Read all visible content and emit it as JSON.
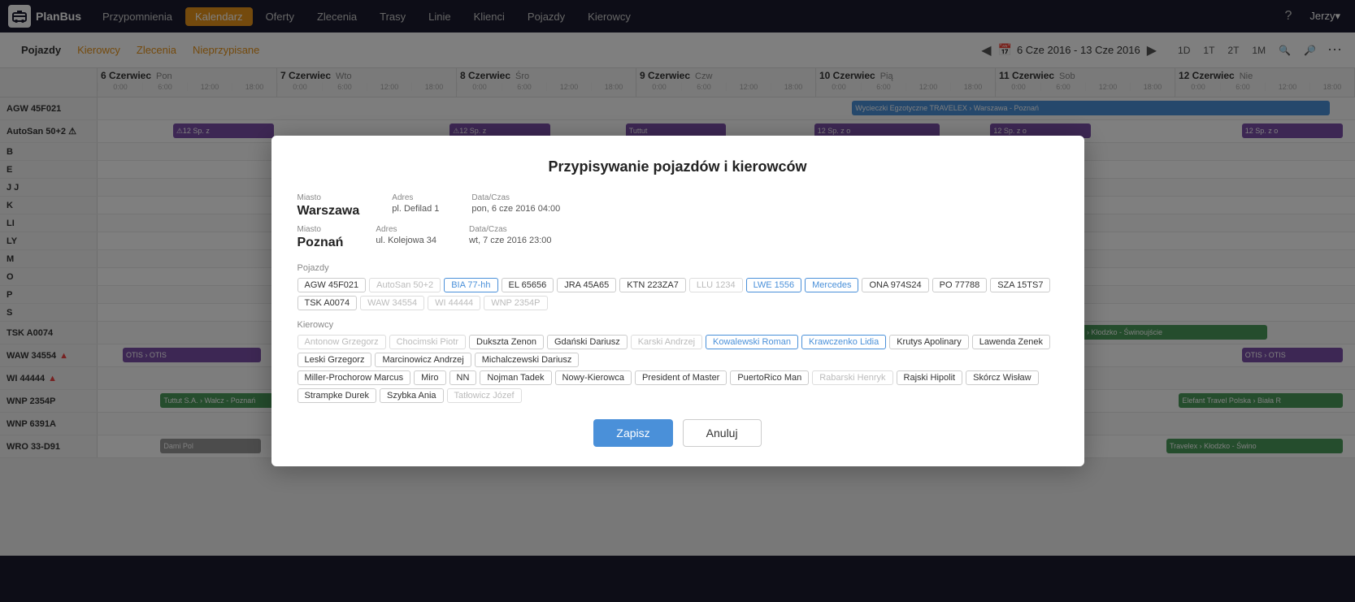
{
  "app": {
    "logo_text": "PlanBus"
  },
  "topnav": {
    "items": [
      {
        "id": "przypomnienia",
        "label": "Przypomnienia",
        "active": false
      },
      {
        "id": "kalendarz",
        "label": "Kalendarz",
        "active": true
      },
      {
        "id": "oferty",
        "label": "Oferty",
        "active": false
      },
      {
        "id": "zlecenia",
        "label": "Zlecenia",
        "active": false
      },
      {
        "id": "trasy",
        "label": "Trasy",
        "active": false
      },
      {
        "id": "linie",
        "label": "Linie",
        "active": false
      },
      {
        "id": "klienci",
        "label": "Klienci",
        "active": false
      },
      {
        "id": "pojazdy",
        "label": "Pojazdy",
        "active": false
      },
      {
        "id": "kierowcy",
        "label": "Kierowcy",
        "active": false
      }
    ],
    "user_label": "Jerzy▾",
    "help_label": "?"
  },
  "subheader": {
    "tabs": [
      {
        "id": "pojazdy",
        "label": "Pojazdy",
        "active": true,
        "orange": false
      },
      {
        "id": "kierowcy",
        "label": "Kierowcy",
        "active": false,
        "orange": true
      },
      {
        "id": "zlecenia",
        "label": "Zlecenia",
        "active": false,
        "orange": true
      },
      {
        "id": "nieprzypisane",
        "label": "Nieprzypisane",
        "active": false,
        "orange": true
      }
    ],
    "date_range": "6 Cze 2016 - 13 Cze 2016",
    "zoom_buttons": [
      "1D",
      "1T",
      "2T",
      "1M"
    ],
    "zoom_in_icon": "🔍",
    "zoom_out_icon": "🔎"
  },
  "calendar": {
    "days": [
      {
        "date": "6 Czerwiec",
        "day": "Pon",
        "times": [
          "0:00",
          "6:00",
          "12:00",
          "18:00"
        ]
      },
      {
        "date": "7 Czerwiec",
        "day": "Wto",
        "times": [
          "0:00",
          "6:00",
          "12:00",
          "18:00"
        ]
      },
      {
        "date": "8 Czerwiec",
        "day": "Śro",
        "times": [
          "0:00",
          "6:00",
          "12:00",
          "18:00"
        ]
      },
      {
        "date": "9 Czerwiec",
        "day": "Czw",
        "times": [
          "0:00",
          "6:00",
          "12:00",
          "18:00"
        ]
      },
      {
        "date": "10 Czerwiec",
        "day": "Pią",
        "times": [
          "0:00",
          "6:00",
          "12:00",
          "18:00"
        ]
      },
      {
        "date": "11 Czerwiec",
        "day": "Sob",
        "times": [
          "0:00",
          "6:00",
          "12:00",
          "18:00"
        ]
      },
      {
        "date": "12 Czerwiec",
        "day": "Nie",
        "times": [
          "0:00",
          "6:00",
          "12:00",
          "18:00"
        ]
      }
    ],
    "vehicles": [
      {
        "id": "AGW45F021",
        "label": "AGW 45F021"
      },
      {
        "id": "AutoSan50",
        "label": "AutoSan 50+2"
      },
      {
        "id": "B",
        "label": "B"
      },
      {
        "id": "E",
        "label": "E"
      },
      {
        "id": "JJ",
        "label": "J J"
      },
      {
        "id": "K",
        "label": "K"
      },
      {
        "id": "LI",
        "label": "LI"
      },
      {
        "id": "LY",
        "label": "LY"
      },
      {
        "id": "M",
        "label": "M"
      },
      {
        "id": "O",
        "label": "O"
      },
      {
        "id": "P",
        "label": "P"
      },
      {
        "id": "S",
        "label": "S"
      }
    ]
  },
  "modal": {
    "title": "Przypisywanie pojazdów i kierowców",
    "from": {
      "city_label": "Miasto",
      "city": "Warszawa",
      "addr_label": "Adres",
      "addr": "pl. Defilad 1",
      "dt_label": "Data/Czas",
      "dt": "pon, 6 cze 2016 04:00"
    },
    "to": {
      "city_label": "Miasto",
      "city": "Poznań",
      "addr_label": "Adres",
      "addr": "ul. Kolejowa 34",
      "dt_label": "Data/Czas",
      "dt": "wt, 7 cze 2016 23:00"
    },
    "vehicles_label": "Pojazdy",
    "vehicles": [
      {
        "id": "AGW45F021",
        "label": "AGW 45F021",
        "selected": "none"
      },
      {
        "id": "AutoSan50",
        "label": "AutoSan 50+2",
        "selected": "none"
      },
      {
        "id": "BIA77hh",
        "label": "BIA 77-hh",
        "selected": "blue"
      },
      {
        "id": "EL65656",
        "label": "EL 65656",
        "selected": "none"
      },
      {
        "id": "JRA45A65",
        "label": "JRA 45A65",
        "selected": "none"
      },
      {
        "id": "KTN223ZA7",
        "label": "KTN 223ZA7",
        "selected": "none"
      },
      {
        "id": "LLU1234",
        "label": "LLU 1234",
        "selected": "none"
      },
      {
        "id": "LWE1556",
        "label": "LWE 1556",
        "selected": "blue"
      },
      {
        "id": "Mercedes",
        "label": "Mercedes",
        "selected": "blue"
      },
      {
        "id": "ONA974S24",
        "label": "ONA 974S24",
        "selected": "none"
      },
      {
        "id": "PO77788",
        "label": "PO 77788",
        "selected": "none"
      },
      {
        "id": "SZA15TS7",
        "label": "SZA 15TS7",
        "selected": "none"
      },
      {
        "id": "TSKA0074",
        "label": "TSK A0074",
        "selected": "none"
      },
      {
        "id": "WAW34554",
        "label": "WAW 34554",
        "selected": "none"
      },
      {
        "id": "WI44444",
        "label": "WI 44444",
        "selected": "none"
      },
      {
        "id": "WNP2354P",
        "label": "WNP 2354P",
        "selected": "none"
      }
    ],
    "drivers_label": "Kierowcy",
    "drivers": [
      {
        "id": "AntonowG",
        "label": "Antonow Grzegorz",
        "selected": "grayed"
      },
      {
        "id": "ChocimkiP",
        "label": "Chocimski Piotr",
        "selected": "grayed"
      },
      {
        "id": "DuksztaZ",
        "label": "Dukszta Zenon",
        "selected": "none"
      },
      {
        "id": "GdanskiD",
        "label": "Gdański Dariusz",
        "selected": "none"
      },
      {
        "id": "KarskiA",
        "label": "Karski Andrzej",
        "selected": "grayed"
      },
      {
        "id": "KowalewskiR",
        "label": "Kowalewski Roman",
        "selected": "blue"
      },
      {
        "id": "KrawczenkoL",
        "label": "Krawczenko Lidia",
        "selected": "blue"
      },
      {
        "id": "KrutysA",
        "label": "Krutys Apolinary",
        "selected": "none"
      },
      {
        "id": "LLawendaZ",
        "label": "Lawenda Zenek",
        "selected": "none"
      },
      {
        "id": "LeskiG",
        "label": "Leski Grzegorz",
        "selected": "none"
      },
      {
        "id": "MarcinowiczA",
        "label": "Marcinowicz Andrzej",
        "selected": "none"
      },
      {
        "id": "MichalczewskiD",
        "label": "Michalczewski Dariusz",
        "selected": "none"
      },
      {
        "id": "MillerPM",
        "label": "Miller-Prochorow Marcus",
        "selected": "none"
      },
      {
        "id": "Miro",
        "label": "Miro",
        "selected": "none"
      },
      {
        "id": "NN",
        "label": "NN",
        "selected": "none"
      },
      {
        "id": "NojmanT",
        "label": "Nojman Tadek",
        "selected": "none"
      },
      {
        "id": "NowyKierowca",
        "label": "Nowy-Kierowca",
        "selected": "none"
      },
      {
        "id": "PresidentOfMaster",
        "label": "President of Master",
        "selected": "none"
      },
      {
        "id": "PuertoRicoMan",
        "label": "PuertoRico Man",
        "selected": "none"
      },
      {
        "id": "RabarskiH",
        "label": "Rabarski Henryk",
        "selected": "grayed"
      },
      {
        "id": "RajskiH",
        "label": "Rajski Hipolit",
        "selected": "none"
      },
      {
        "id": "SkórczW",
        "label": "Skórcz Wisław",
        "selected": "none"
      },
      {
        "id": "StrampkeD",
        "label": "Strampke Durek",
        "selected": "none"
      },
      {
        "id": "SzybkaA",
        "label": "Szybka Ania",
        "selected": "none"
      },
      {
        "id": "TatłowiczJ",
        "label": "Tatłowicz Józef",
        "selected": "grayed"
      }
    ],
    "btn_save": "Zapisz",
    "btn_cancel": "Anuluj"
  },
  "bottom_rows": [
    {
      "label": "TSK A0074",
      "events": []
    },
    {
      "label": "WAW 34554",
      "events": []
    },
    {
      "label": "WI 44444",
      "events": []
    },
    {
      "label": "WNP 2354P",
      "events": []
    },
    {
      "label": "WNP 6391A",
      "events": []
    },
    {
      "label": "WRO 33-D91",
      "events": []
    }
  ]
}
